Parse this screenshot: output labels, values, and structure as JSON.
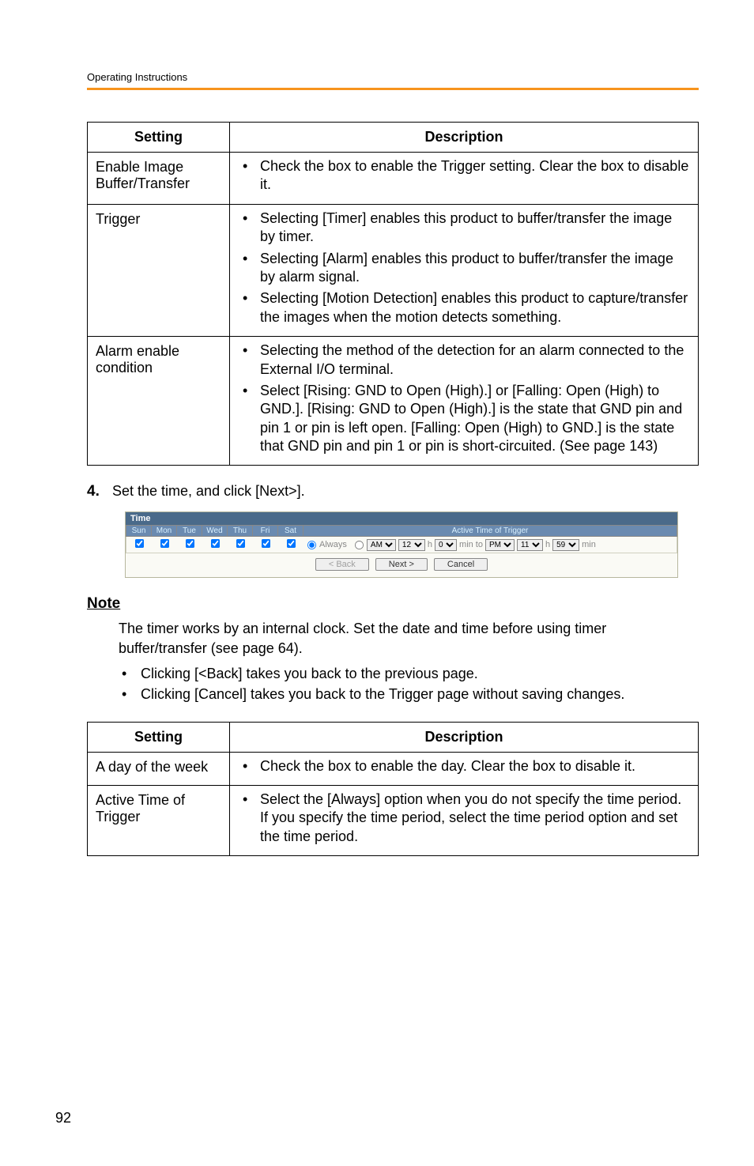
{
  "header": "Operating Instructions",
  "table1": {
    "headers": {
      "setting": "Setting",
      "description": "Description"
    },
    "rows": [
      {
        "name": "Enable Image Buffer/Transfer",
        "bullets": [
          "Check the box to enable the Trigger setting. Clear the box to disable it."
        ]
      },
      {
        "name": "Trigger",
        "bullets": [
          "Selecting [Timer] enables this product to buffer/transfer the image by timer.",
          "Selecting [Alarm] enables this product to buffer/transfer the image by alarm signal.",
          "Selecting [Motion Detection] enables this product to capture/transfer the images when the motion detects something."
        ]
      },
      {
        "name": "Alarm enable condition",
        "bullets": [
          "Selecting the method of the detection for an alarm connected to the External I/O terminal.",
          "Select [Rising: GND to Open (High).] or [Falling: Open (High) to GND.]. [Rising: GND to Open (High).] is the state that GND pin and pin 1 or pin is left open. [Falling: Open (High) to GND.] is the state that GND pin and pin 1 or pin is short-circuited. (See page 143)"
        ]
      }
    ]
  },
  "step": {
    "num": "4.",
    "text": "Set the time, and click [Next>]."
  },
  "time": {
    "title": "Time",
    "days": [
      "Sun",
      "Mon",
      "Tue",
      "Wed",
      "Thu",
      "Fri",
      "Sat"
    ],
    "trigger_label": "Active Time of Trigger",
    "always": "Always",
    "ampm1": "AM",
    "h1": "12",
    "m1": "0",
    "minto": "min to",
    "ampm2": "PM",
    "h2": "11",
    "m2": "59",
    "h_lbl": "h",
    "min_lbl": "min",
    "back": "< Back",
    "next": "Next >",
    "cancel": "Cancel"
  },
  "note": {
    "heading": "Note",
    "body": "The timer works by an internal clock. Set the date and time before using timer buffer/transfer (see page 64).",
    "bullets": [
      "Clicking [<Back] takes you back to the previous page.",
      "Clicking [Cancel] takes you back to the Trigger page without saving changes."
    ]
  },
  "table2": {
    "headers": {
      "setting": "Setting",
      "description": "Description"
    },
    "rows": [
      {
        "name": "A day of the week",
        "bullets": [
          "Check the box to enable the day. Clear the box to disable it."
        ]
      },
      {
        "name": "Active Time of Trigger",
        "bullets": [
          "Select the [Always] option when you do not specify the time period. If you specify the time period, select the time period option and set the time period."
        ]
      }
    ]
  },
  "page_number": "92"
}
